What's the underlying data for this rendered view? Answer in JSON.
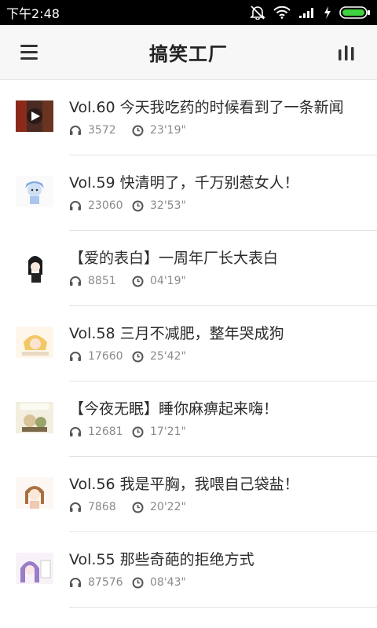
{
  "status_bar": {
    "time": "下午2:48",
    "icons": [
      "mute-icon",
      "wifi-icon",
      "signal-icon",
      "charging-icon",
      "battery-icon"
    ]
  },
  "header": {
    "title": "搞笑工厂",
    "menu_icon": "menu-icon",
    "stats_icon": "stats-icon"
  },
  "episodes": [
    {
      "title": "Vol.60 今天我吃药的时候看到了一条新闻",
      "plays": "3572",
      "duration": "23'19\""
    },
    {
      "title": "Vol.59 快清明了，千万别惹女人！",
      "plays": "23060",
      "duration": "32'53\""
    },
    {
      "title": "【爱的表白】一周年厂长大表白",
      "plays": "8851",
      "duration": "04'19\""
    },
    {
      "title": "Vol.58 三月不减肥，整年哭成狗",
      "plays": "17660",
      "duration": "25'42\""
    },
    {
      "title": "【今夜无眠】睡你麻痹起来嗨！",
      "plays": "12681",
      "duration": "17'21\""
    },
    {
      "title": "Vol.56 我是平胸，我喂自己袋盐！",
      "plays": "7868",
      "duration": "20'22\""
    },
    {
      "title": "Vol.55 那些奇葩的拒绝方式",
      "plays": "87576",
      "duration": "08'43\""
    }
  ],
  "colors": {
    "status_bar_bg": "#000000",
    "app_bar_bg": "#f7f7f7",
    "title_text": "#2b2b2b",
    "meta_text": "#8a8a8a",
    "divider": "#e3e3e3"
  }
}
